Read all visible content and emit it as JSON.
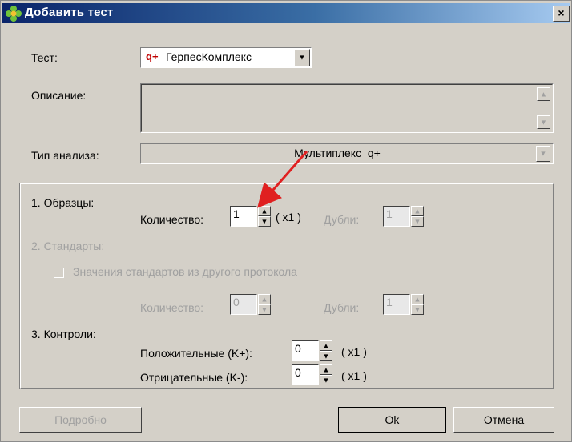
{
  "window": {
    "title": "Добавить тест",
    "close_glyph": "×"
  },
  "test": {
    "label": "Тест:",
    "badge": "q+",
    "value": "ГерпесКомплекс",
    "badge_color": "#c00000"
  },
  "description": {
    "label": "Описание:",
    "value": ""
  },
  "analysis_type": {
    "label": "Тип анализа:",
    "value": "Мультиплекс_q+"
  },
  "samples": {
    "heading": "1. Образцы:",
    "count_label": "Количество:",
    "count_value": "1",
    "multiplier": "( x1 )",
    "duplicates_label": "Дубли:",
    "duplicates_value": "1"
  },
  "standards": {
    "heading": "2. Стандарты:",
    "checkbox_label": "Значения стандартов из другого протокола",
    "count_label": "Количество:",
    "count_value": "0",
    "duplicates_label": "Дубли:",
    "duplicates_value": "1"
  },
  "controls": {
    "heading": "3. Контроли:",
    "positive_label": "Положительные (K+):",
    "positive_value": "0",
    "positive_multiplier": "( x1 )",
    "negative_label": "Отрицательные (K-):",
    "negative_value": "0",
    "negative_multiplier": "( x1 )"
  },
  "buttons": {
    "details": "Подробно",
    "ok": "Ok",
    "cancel": "Отмена"
  },
  "annotation_color": "#e02020"
}
